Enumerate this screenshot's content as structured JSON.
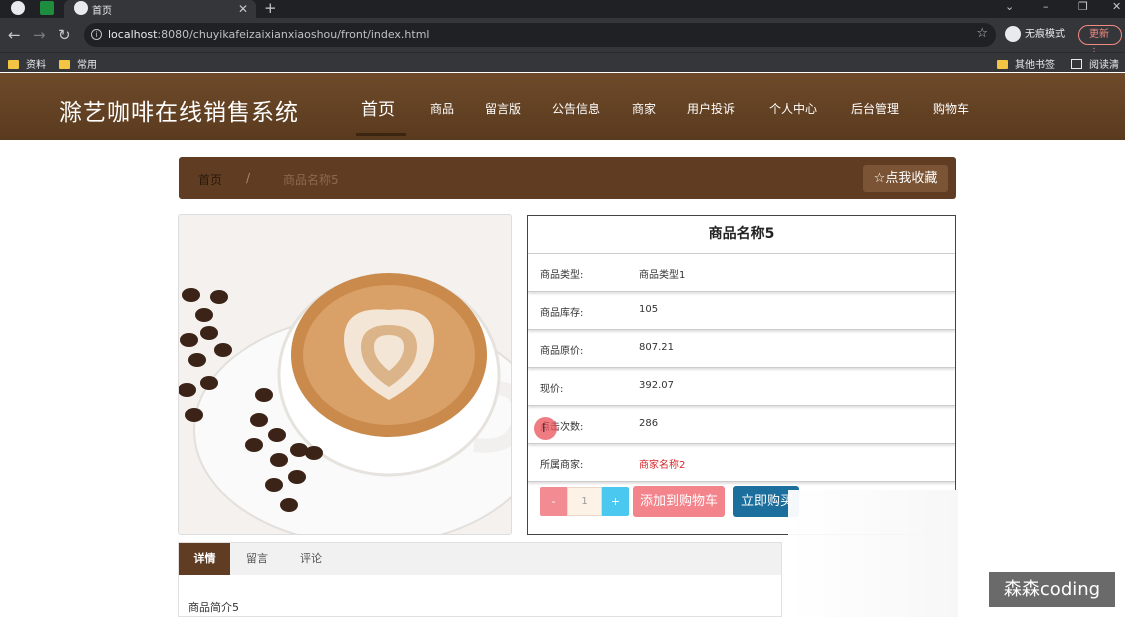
{
  "browser": {
    "tab_title": "首页",
    "url_host": "localhost",
    "url_rest": ":8080/chuyikafeizaixianxiaoshou/front/index.html",
    "incognito_label": "无痕模式",
    "update_label": "更新",
    "bookmarks": [
      "资料",
      "常用"
    ],
    "bookmarks_right": [
      "其他书签",
      "阅读清单"
    ]
  },
  "site": {
    "title": "滁艺咖啡在线销售系统",
    "nav": [
      "首页",
      "商品",
      "留言版",
      "公告信息",
      "商家",
      "用户投诉",
      "个人中心",
      "后台管理",
      "购物车"
    ]
  },
  "breadcrumb": {
    "home": "首页",
    "separator": "/",
    "current": "商品名称5",
    "favorite_label": "☆点我收藏"
  },
  "product": {
    "name": "商品名称5",
    "rows": [
      {
        "label": "商品类型:",
        "value": "商品类型1"
      },
      {
        "label": "商品库存:",
        "value": "105"
      },
      {
        "label": "商品原价:",
        "value": "807.21"
      },
      {
        "label": "现价:",
        "value": "392.07"
      },
      {
        "label": "点击次数:",
        "value": "286"
      },
      {
        "label": "所属商家:",
        "value": "商家名称2"
      }
    ],
    "quantity": "1",
    "minus_label": "-",
    "plus_label": "+",
    "add_to_cart_label": "添加到购物车",
    "buy_now_label": "立即购买"
  },
  "tabs": {
    "items": [
      "详情",
      "留言",
      "评论"
    ],
    "active": 0,
    "description": "商品简介5"
  },
  "watermark": "森森coding",
  "colors": {
    "header_brown": "#6e4a2a",
    "crumb_brown": "#5f3c22",
    "cart_pink": "#f4848c",
    "buy_blue": "#1c6e9c",
    "merchant_red": "#d62828"
  }
}
